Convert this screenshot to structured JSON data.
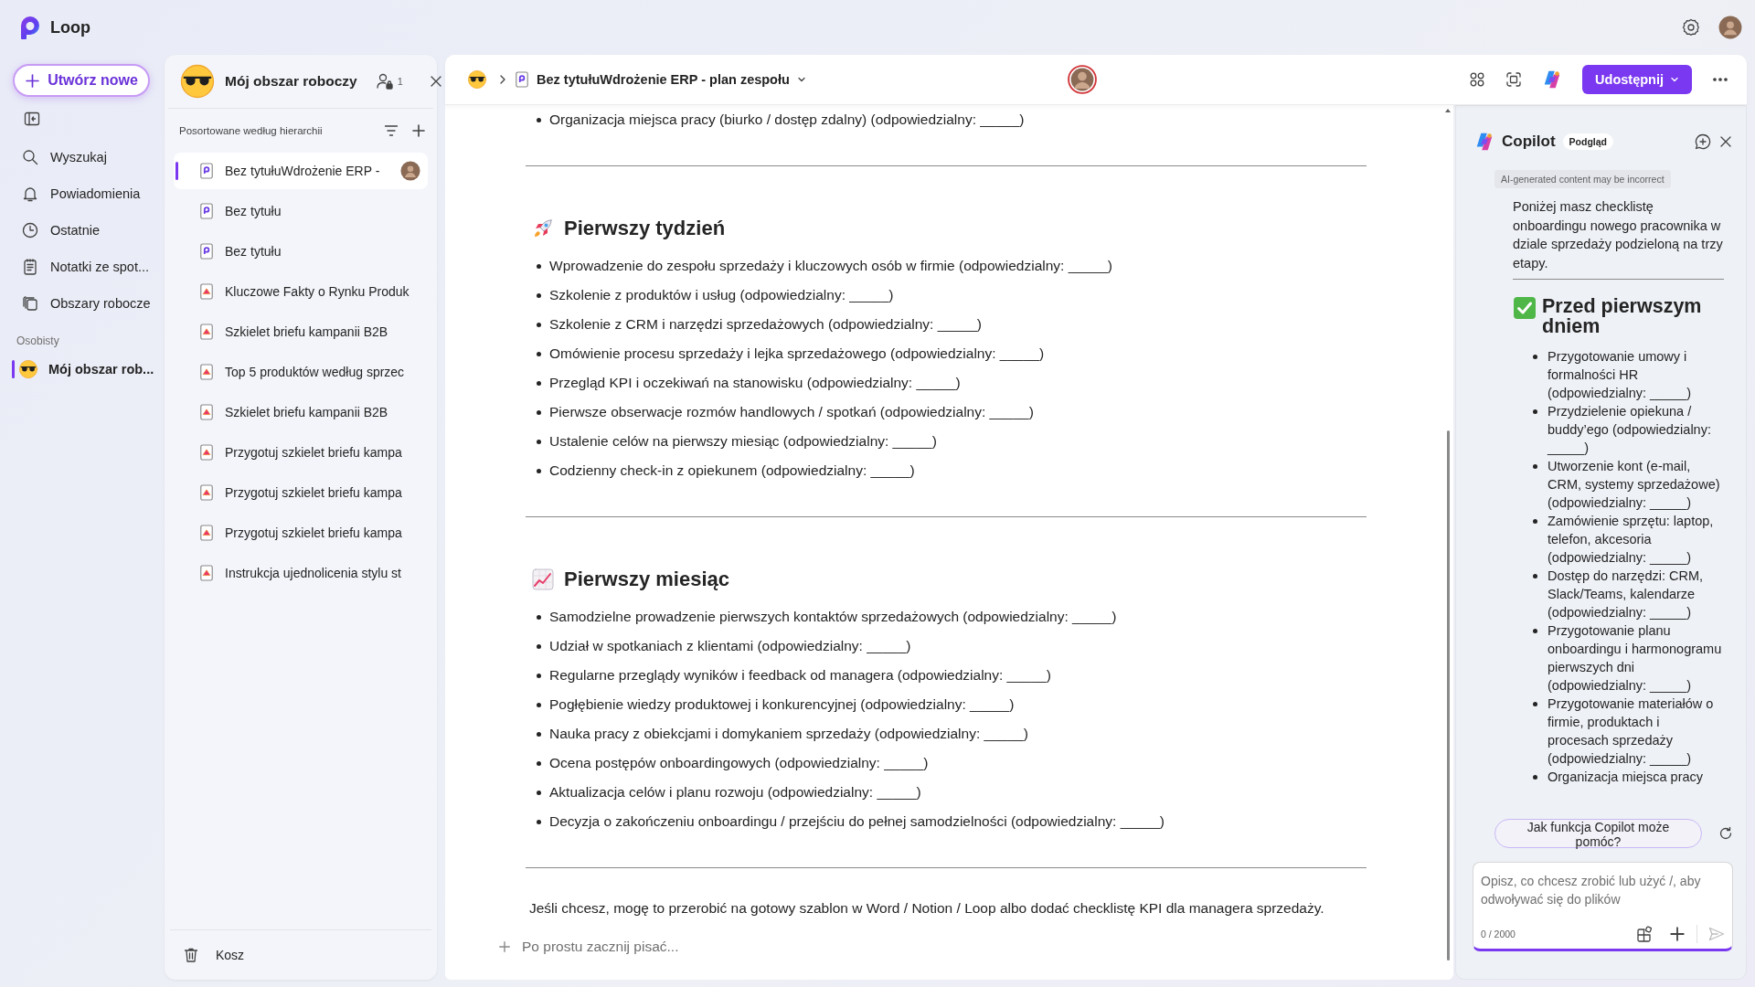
{
  "app": {
    "name": "Loop"
  },
  "nav": {
    "create_label": "Utwórz nowe",
    "items": [
      {
        "label": "Wyszukaj",
        "selected": false
      },
      {
        "label": "Powiadomienia",
        "selected": false
      },
      {
        "label": "Ostatnie",
        "selected": false
      },
      {
        "label": "Notatki ze spot...",
        "selected": false
      },
      {
        "label": "Obszary robocze",
        "selected": false
      }
    ],
    "section": "Osobisty",
    "workspaces": [
      {
        "label": "Mój obszar rob...",
        "selected": true
      }
    ]
  },
  "workspace_panel": {
    "title": "Mój obszar roboczy",
    "member_count": "1",
    "sort_label": "Posortowane według hierarchii",
    "pages": [
      {
        "title": "Bez tytułuWdrożenie ERP -",
        "kind": "loop",
        "selected": true
      },
      {
        "title": "Bez tytułu",
        "kind": "loop",
        "selected": false
      },
      {
        "title": "Bez tytułu",
        "kind": "loop",
        "selected": false
      },
      {
        "title": "Kluczowe Fakty o Rynku Produk",
        "kind": "page",
        "selected": false
      },
      {
        "title": "Szkielet briefu kampanii B2B",
        "kind": "page",
        "selected": false
      },
      {
        "title": "Top 5 produktów według sprzec",
        "kind": "page",
        "selected": false
      },
      {
        "title": "Szkielet briefu kampanii B2B",
        "kind": "page",
        "selected": false
      },
      {
        "title": "Przygotuj szkielet briefu kampa",
        "kind": "page",
        "selected": false
      },
      {
        "title": "Przygotuj szkielet briefu kampa",
        "kind": "page",
        "selected": false
      },
      {
        "title": "Przygotuj szkielet briefu kampa",
        "kind": "page",
        "selected": false
      },
      {
        "title": "Instrukcja ujednolicenia stylu st",
        "kind": "page",
        "selected": false
      }
    ],
    "trash": "Kosz"
  },
  "document": {
    "breadcrumb": "Bez tytułuWdrożenie ERP - plan zespołu",
    "share_label": "Udostępnij",
    "blocks": [
      {
        "kind": "bullet",
        "text": "Organizacja miejsca pracy (biurko / dostęp zdalny) (odpowiedzialny: _____)"
      },
      {
        "kind": "divider"
      },
      {
        "kind": "heading",
        "text": "Pierwszy tydzień"
      },
      {
        "kind": "bullet",
        "text": "Wprowadzenie do zespołu sprzedaży i kluczowych osób w firmie (odpowiedzialny: _____)"
      },
      {
        "kind": "bullet",
        "text": "Szkolenie z produktów i usług (odpowiedzialny: _____)"
      },
      {
        "kind": "bullet",
        "text": "Szkolenie z CRM i narzędzi sprzedażowych (odpowiedzialny: _____)"
      },
      {
        "kind": "bullet",
        "text": "Omówienie procesu sprzedaży i lejka sprzedażowego (odpowiedzialny: _____)"
      },
      {
        "kind": "bullet",
        "text": "Przegląd KPI i oczekiwań na stanowisku (odpowiedzialny: _____)"
      },
      {
        "kind": "bullet",
        "text": "Pierwsze obserwacje rozmów handlowych / spotkań (odpowiedzialny: _____)"
      },
      {
        "kind": "bullet",
        "text": "Ustalenie celów na pierwszy miesiąc (odpowiedzialny: _____)"
      },
      {
        "kind": "bullet",
        "text": "Codzienny check-in z opiekunem (odpowiedzialny: _____)"
      },
      {
        "kind": "divider"
      },
      {
        "kind": "heading",
        "text": "Pierwszy miesiąc"
      },
      {
        "kind": "bullet",
        "text": "Samodzielne prowadzenie pierwszych kontaktów sprzedażowych (odpowiedzialny: _____)"
      },
      {
        "kind": "bullet",
        "text": "Udział w spotkaniach z klientami (odpowiedzialny: _____)"
      },
      {
        "kind": "bullet",
        "text": "Regularne przeglądy wyników i feedback od managera (odpowiedzialny: _____)"
      },
      {
        "kind": "bullet",
        "text": "Pogłębienie wiedzy produktowej i konkurencyjnej (odpowiedzialny: _____)"
      },
      {
        "kind": "bullet",
        "text": "Nauka pracy z obiekcjami i domykaniem sprzedaży (odpowiedzialny: _____)"
      },
      {
        "kind": "bullet",
        "text": "Ocena postępów onboardingowych (odpowiedzialny: _____)"
      },
      {
        "kind": "bullet",
        "text": "Aktualizacja celów i planu rozwoju (odpowiedzialny: _____)"
      },
      {
        "kind": "bullet",
        "text": "Decyzja o zakończeniu onboardingu / przejściu do pełnej samodzielności (odpowiedzialny: _____)"
      },
      {
        "kind": "divider"
      },
      {
        "kind": "paragraph",
        "text": "Jeśli chcesz, mogę to przerobić na gotowy szablon w Word / Notion / Loop albo dodać checklistę KPI dla managera sprzedaży."
      }
    ],
    "placeholder": "Po prostu zacznij pisać..."
  },
  "copilot": {
    "title": "Copilot",
    "badge": "Podgląd",
    "disclaimer": "AI-generated content may be incorrect",
    "intro": "Poniżej masz checklistę onboardingu nowego pracownika w dziale sprzedaży podzieloną na trzy etapy.",
    "heading": "Przed pierwszym dniem",
    "bullets": [
      "Przygotowanie umowy i formalności HR (odpowiedzialny: _____)",
      "Przydzielenie opiekuna / buddy’ego (odpowiedzialny: _____)",
      "Utworzenie kont (e-mail, CRM, systemy sprzedażowe) (odpowiedzialny: _____)",
      "Zamówienie sprzętu: laptop, telefon, akcesoria (odpowiedzialny: _____)",
      "Dostęp do narzędzi: CRM, Slack/Teams, kalendarze (odpowiedzialny: _____)",
      "Przygotowanie planu onboardingu i harmonogramu pierwszych dni (odpowiedzialny: _____)",
      "Przygotowanie materiałów o firmie, produktach i procesach sprzedaży (odpowiedzialny: _____)",
      "Organizacja miejsca pracy"
    ],
    "suggestion": "Jak funkcja Copilot może pomóc?",
    "placeholder": "Opisz, co chcesz zrobić lub użyć /, aby odwoływać się do plików",
    "counter": "0 / 2000"
  }
}
